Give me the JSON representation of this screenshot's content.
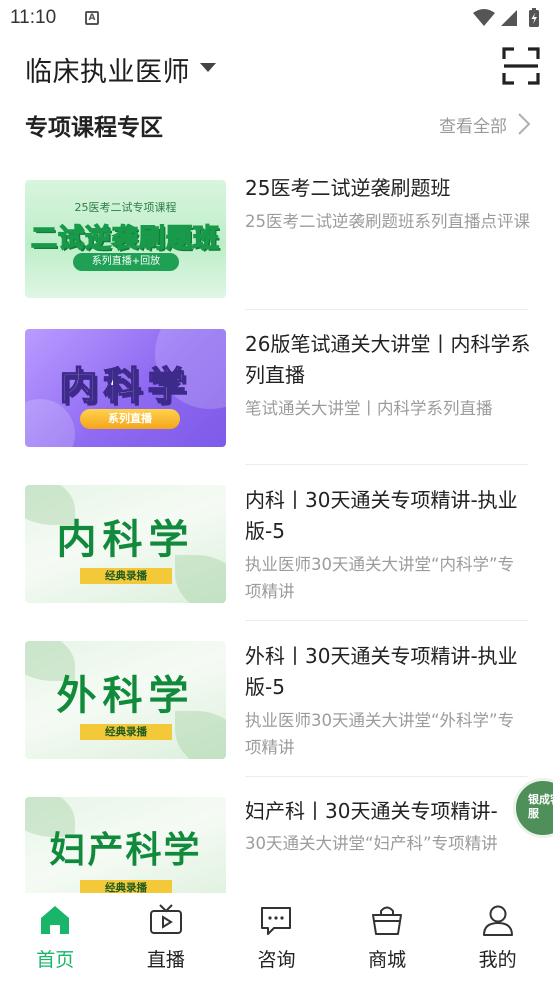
{
  "status_bar": {
    "time": "11:10",
    "notification_icon": "A"
  },
  "header": {
    "title": "临床执业医师",
    "scan_icon": "scan-icon"
  },
  "section": {
    "title": "专项课程专区",
    "view_all": "查看全部"
  },
  "courses": [
    {
      "title": "25医考二试逆袭刷题班",
      "description": "25医考二试逆袭刷题班系列直播点评课",
      "thumb": {
        "top_text": "25医考二试专项课程",
        "main_a": "二试逆袭",
        "main_b": "刷题班",
        "pill": "系列直播+回放"
      }
    },
    {
      "title": "26版笔试通关大讲堂丨内科学系列直播",
      "description": "笔试通关大讲堂丨内科学系列直播",
      "thumb": {
        "main": "内科学",
        "pill": "系列直播"
      }
    },
    {
      "title": "内科丨30天通关专项精讲-执业版-5",
      "description": "执业医师30天通关大讲堂“内科学”专项精讲",
      "thumb": {
        "main": "内科学",
        "pill": "经典录播"
      }
    },
    {
      "title": "外科丨30天通关专项精讲-执业版-5",
      "description": "执业医师30天通关大讲堂“外科学”专项精讲",
      "thumb": {
        "main": "外科学",
        "pill": "经典录播"
      }
    },
    {
      "title": "妇产科丨30天通关专项精讲-",
      "description": "30天通关大讲堂“妇产科”专项精讲",
      "thumb": {
        "main": "妇产科学",
        "pill": "经典录播"
      }
    }
  ],
  "float_badge": {
    "text": "银成客服"
  },
  "tabs": [
    {
      "label": "首页",
      "icon": "home-icon",
      "active": true
    },
    {
      "label": "直播",
      "icon": "tv-icon",
      "active": false
    },
    {
      "label": "咨询",
      "icon": "chat-icon",
      "active": false
    },
    {
      "label": "商城",
      "icon": "basket-icon",
      "active": false
    },
    {
      "label": "我的",
      "icon": "user-icon",
      "active": false
    }
  ],
  "colors": {
    "accent": "#19b56a",
    "text": "#222222",
    "muted": "#9c9c9c"
  }
}
